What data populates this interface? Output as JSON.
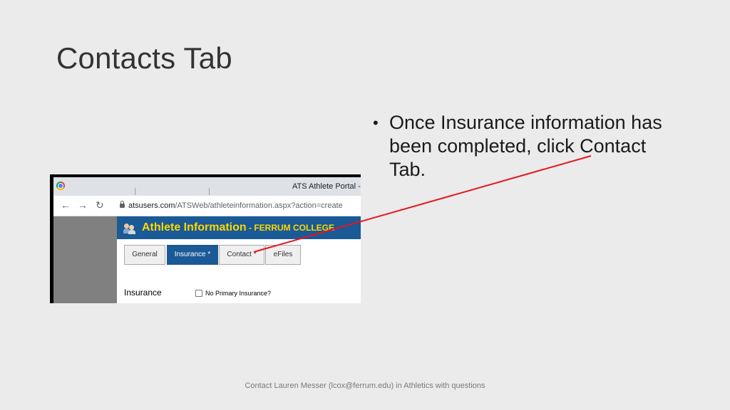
{
  "slide": {
    "title": "Contacts Tab",
    "bullet": "Once Insurance information has been completed, click Contact Tab.",
    "footer": "Contact Lauren Messer (lcox@ferrum.edu) in Athletics with questions"
  },
  "screenshot": {
    "browser": {
      "tab_title": "ATS Athlete Portal - A",
      "url_host": "atsusers.com",
      "url_path": "/ATSWeb/athleteinformation.aspx?action=create",
      "back_icon": "arrow-left-icon",
      "forward_icon": "arrow-right-icon",
      "reload_icon": "reload-icon"
    },
    "header": {
      "title": "Athlete Information",
      "subtitle": " - FERRUM COLLEGE",
      "icon": "users-icon"
    },
    "tabs": [
      {
        "label": "General",
        "active": false
      },
      {
        "label": "Insurance *",
        "active": true
      },
      {
        "label": "Contact *",
        "active": false
      },
      {
        "label": "eFiles",
        "active": false
      }
    ],
    "section_label": "Insurance",
    "checkbox_label": "No Primary Insurance?",
    "checkbox_checked": false
  },
  "colors": {
    "header_band": "#1a5a96",
    "header_text": "#ffd700",
    "arrow": "#e8141c"
  }
}
